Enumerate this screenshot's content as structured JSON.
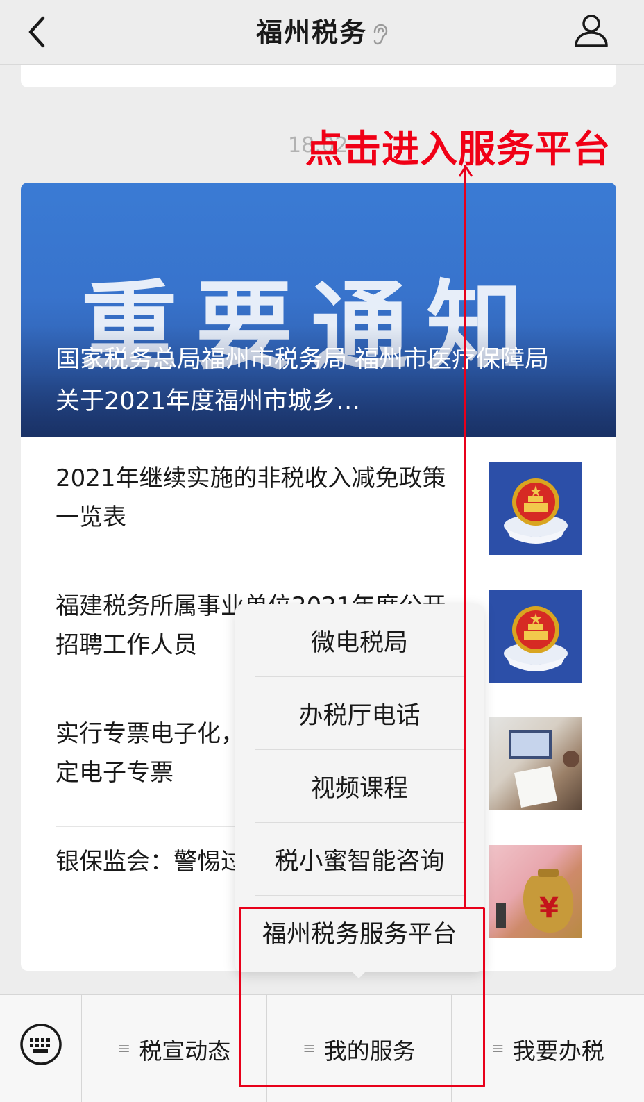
{
  "header": {
    "title": "福州税务"
  },
  "chat": {
    "timestamp": "18:02",
    "annotation": "点击进入服务平台"
  },
  "article": {
    "cover_banner": "重要通知",
    "cover_title": "国家税务总局福州市税务局 福州市医疗保障局 关于2021年度福州市城乡…",
    "items": [
      {
        "title": "2021年继续实施的非税收入减免政策一览表"
      },
      {
        "title": "福建税务所属事业单位2021年度公开招聘工作人员"
      },
      {
        "title": "实行专票电子化，这些事项请注意！核定电子专票"
      },
      {
        "title": "银保监会：警惕过度借贷，关系你"
      }
    ]
  },
  "popup_menu": {
    "items": [
      "微电税局",
      "办税厅电话",
      "视频课程",
      "税小蜜智能咨询",
      "福州税务服务平台"
    ]
  },
  "bottom_menu": {
    "tabs": [
      "税宣动态",
      "我的服务",
      "我要办税"
    ]
  },
  "colors": {
    "annotation_red": "#f00016",
    "cover_blue": "#3a7bd4",
    "emblem_blue": "#2c4fa8"
  },
  "icons": {
    "back": "chevron-left-icon",
    "ear": "ear-icon",
    "profile": "user-icon",
    "keyboard": "keyboard-icon",
    "emblem": "tax-emblem-icon",
    "menu": "hamburger-icon"
  }
}
